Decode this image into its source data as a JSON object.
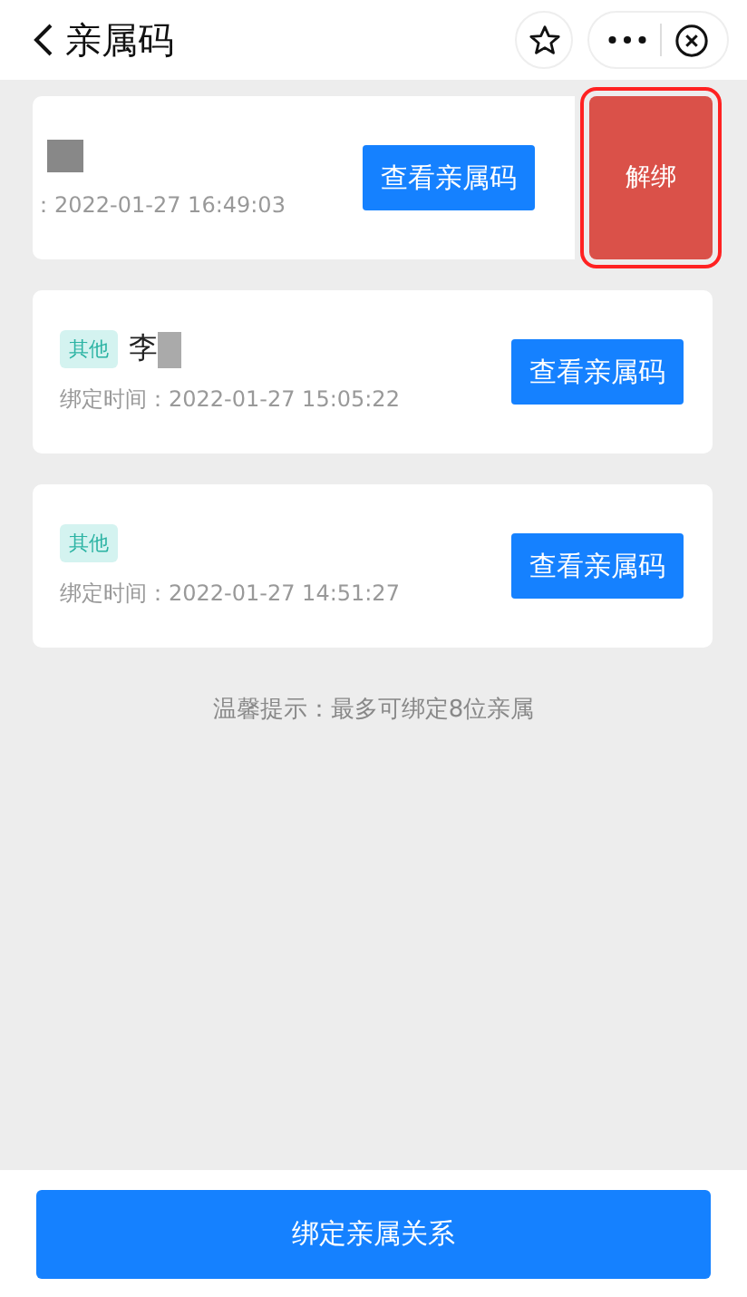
{
  "header": {
    "title": "亲属码"
  },
  "relatives": [
    {
      "swiped": true,
      "redacted": true,
      "bind_time": "：2022-01-27 16:49:03",
      "view_button": "查看亲属码",
      "unbind_button": "解绑",
      "highlighted": true
    },
    {
      "swiped": false,
      "tag": "其他",
      "name": "李",
      "redacted": true,
      "bind_time": "绑定时间：2022-01-27 15:05:22",
      "view_button": "查看亲属码"
    },
    {
      "swiped": false,
      "tag": "其他",
      "redacted": false,
      "bind_time": "绑定时间：2022-01-27 14:51:27",
      "view_button": "查看亲属码"
    }
  ],
  "hint": "温馨提示：最多可绑定8位亲属",
  "bottom_button": "绑定亲属关系"
}
